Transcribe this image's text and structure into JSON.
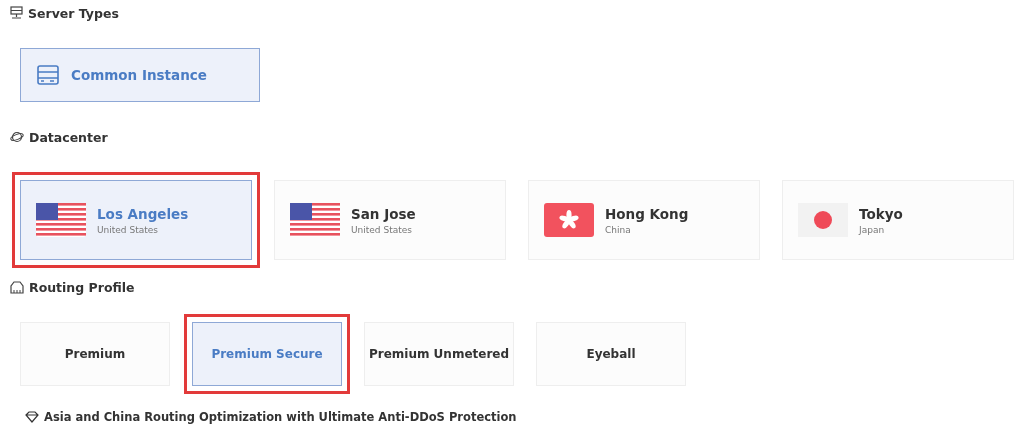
{
  "server_types": {
    "title": "Server Types",
    "items": [
      {
        "label": "Common Instance",
        "selected": true
      }
    ]
  },
  "datacenter": {
    "title": "Datacenter",
    "items": [
      {
        "city": "Los Angeles",
        "country": "United States",
        "kind": "us",
        "selected": true,
        "annotated": true
      },
      {
        "city": "San Jose",
        "country": "United States",
        "kind": "us",
        "selected": false,
        "annotated": false
      },
      {
        "city": "Hong Kong",
        "country": "China",
        "kind": "hk",
        "selected": false,
        "annotated": false
      },
      {
        "city": "Tokyo",
        "country": "Japan",
        "kind": "jp",
        "selected": false,
        "annotated": false
      }
    ]
  },
  "routing_profile": {
    "title": "Routing Profile",
    "items": [
      {
        "label": "Premium",
        "selected": false,
        "annotated": false
      },
      {
        "label": "Premium Secure",
        "selected": true,
        "annotated": true
      },
      {
        "label": "Premium Unmetered",
        "selected": false,
        "annotated": false
      },
      {
        "label": "Eyeball",
        "selected": false,
        "annotated": false
      }
    ],
    "note": "Asia and China Routing Optimization with Ultimate Anti-DDoS Protection"
  }
}
